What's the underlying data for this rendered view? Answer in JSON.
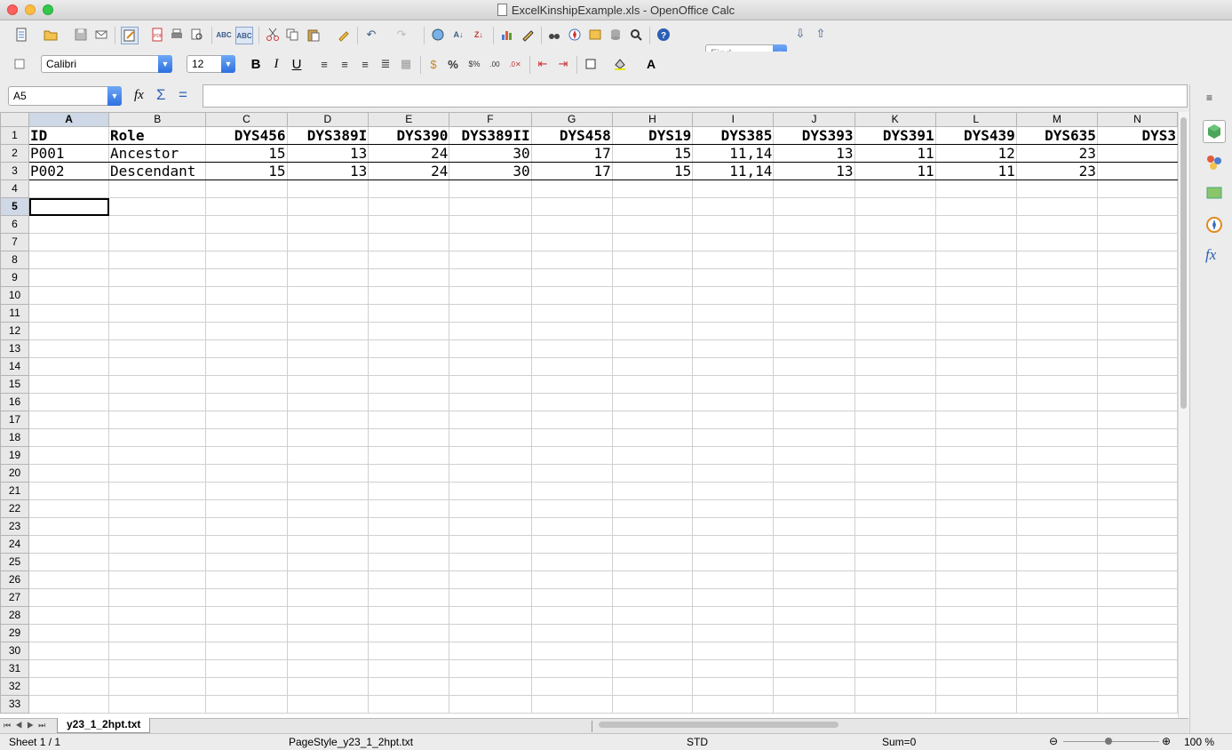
{
  "window": {
    "title": "ExcelKinshipExample.xls - OpenOffice Calc"
  },
  "toolbar": {
    "find_placeholder": "Find",
    "font_name": "Calibri",
    "font_size": "12",
    "bold_label": "B",
    "italic_label": "I",
    "underline_label": "U"
  },
  "formula_bar": {
    "name_box": "A5",
    "fx_label": "fx",
    "sum_label": "Σ",
    "equals_label": "=",
    "content": ""
  },
  "sheet": {
    "columns": [
      "A",
      "B",
      "C",
      "D",
      "E",
      "F",
      "G",
      "H",
      "I",
      "J",
      "K",
      "L",
      "M",
      "N"
    ],
    "row_count": 33,
    "selected_cell": "A5",
    "rows": [
      [
        "ID",
        "Role",
        "DYS456",
        "DYS389I",
        "DYS390",
        "DYS389II",
        "DYS458",
        "DYS19",
        "DYS385",
        "DYS393",
        "DYS391",
        "DYS439",
        "DYS635",
        "DYS3"
      ],
      [
        "P001",
        "Ancestor",
        "15",
        "13",
        "24",
        "30",
        "17",
        "15",
        "11,14",
        "13",
        "11",
        "12",
        "23",
        ""
      ],
      [
        "P002",
        "Descendant",
        "15",
        "13",
        "24",
        "30",
        "17",
        "15",
        "11,14",
        "13",
        "11",
        "11",
        "23",
        ""
      ]
    ]
  },
  "tabs": [
    {
      "label": "y23_1_2hpt.txt"
    }
  ],
  "status": {
    "sheet": "Sheet 1 / 1",
    "page_style": "PageStyle_y23_1_2hpt.txt",
    "mode": "STD",
    "sum": "Sum=0",
    "zoom": "100 %"
  }
}
